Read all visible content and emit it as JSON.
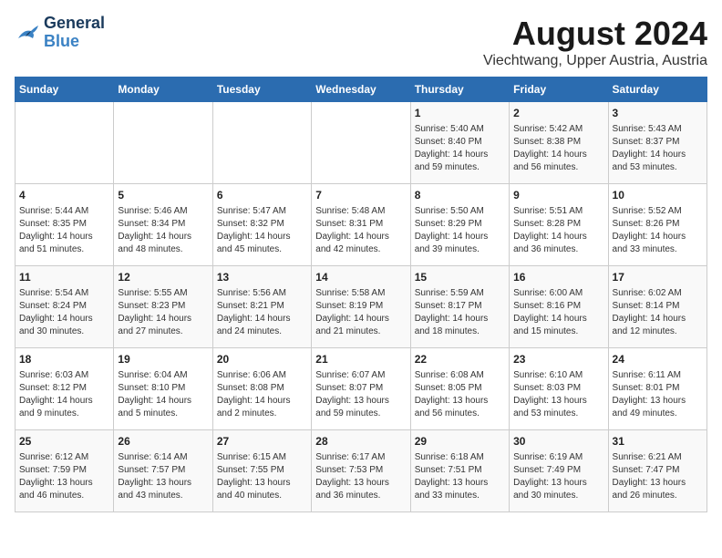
{
  "header": {
    "logo_line1": "General",
    "logo_line2": "Blue",
    "title": "August 2024",
    "subtitle": "Viechtwang, Upper Austria, Austria"
  },
  "calendar": {
    "days_of_week": [
      "Sunday",
      "Monday",
      "Tuesday",
      "Wednesday",
      "Thursday",
      "Friday",
      "Saturday"
    ],
    "weeks": [
      [
        {
          "day": "",
          "detail": ""
        },
        {
          "day": "",
          "detail": ""
        },
        {
          "day": "",
          "detail": ""
        },
        {
          "day": "",
          "detail": ""
        },
        {
          "day": "1",
          "detail": "Sunrise: 5:40 AM\nSunset: 8:40 PM\nDaylight: 14 hours\nand 59 minutes."
        },
        {
          "day": "2",
          "detail": "Sunrise: 5:42 AM\nSunset: 8:38 PM\nDaylight: 14 hours\nand 56 minutes."
        },
        {
          "day": "3",
          "detail": "Sunrise: 5:43 AM\nSunset: 8:37 PM\nDaylight: 14 hours\nand 53 minutes."
        }
      ],
      [
        {
          "day": "4",
          "detail": "Sunrise: 5:44 AM\nSunset: 8:35 PM\nDaylight: 14 hours\nand 51 minutes."
        },
        {
          "day": "5",
          "detail": "Sunrise: 5:46 AM\nSunset: 8:34 PM\nDaylight: 14 hours\nand 48 minutes."
        },
        {
          "day": "6",
          "detail": "Sunrise: 5:47 AM\nSunset: 8:32 PM\nDaylight: 14 hours\nand 45 minutes."
        },
        {
          "day": "7",
          "detail": "Sunrise: 5:48 AM\nSunset: 8:31 PM\nDaylight: 14 hours\nand 42 minutes."
        },
        {
          "day": "8",
          "detail": "Sunrise: 5:50 AM\nSunset: 8:29 PM\nDaylight: 14 hours\nand 39 minutes."
        },
        {
          "day": "9",
          "detail": "Sunrise: 5:51 AM\nSunset: 8:28 PM\nDaylight: 14 hours\nand 36 minutes."
        },
        {
          "day": "10",
          "detail": "Sunrise: 5:52 AM\nSunset: 8:26 PM\nDaylight: 14 hours\nand 33 minutes."
        }
      ],
      [
        {
          "day": "11",
          "detail": "Sunrise: 5:54 AM\nSunset: 8:24 PM\nDaylight: 14 hours\nand 30 minutes."
        },
        {
          "day": "12",
          "detail": "Sunrise: 5:55 AM\nSunset: 8:23 PM\nDaylight: 14 hours\nand 27 minutes."
        },
        {
          "day": "13",
          "detail": "Sunrise: 5:56 AM\nSunset: 8:21 PM\nDaylight: 14 hours\nand 24 minutes."
        },
        {
          "day": "14",
          "detail": "Sunrise: 5:58 AM\nSunset: 8:19 PM\nDaylight: 14 hours\nand 21 minutes."
        },
        {
          "day": "15",
          "detail": "Sunrise: 5:59 AM\nSunset: 8:17 PM\nDaylight: 14 hours\nand 18 minutes."
        },
        {
          "day": "16",
          "detail": "Sunrise: 6:00 AM\nSunset: 8:16 PM\nDaylight: 14 hours\nand 15 minutes."
        },
        {
          "day": "17",
          "detail": "Sunrise: 6:02 AM\nSunset: 8:14 PM\nDaylight: 14 hours\nand 12 minutes."
        }
      ],
      [
        {
          "day": "18",
          "detail": "Sunrise: 6:03 AM\nSunset: 8:12 PM\nDaylight: 14 hours\nand 9 minutes."
        },
        {
          "day": "19",
          "detail": "Sunrise: 6:04 AM\nSunset: 8:10 PM\nDaylight: 14 hours\nand 5 minutes."
        },
        {
          "day": "20",
          "detail": "Sunrise: 6:06 AM\nSunset: 8:08 PM\nDaylight: 14 hours\nand 2 minutes."
        },
        {
          "day": "21",
          "detail": "Sunrise: 6:07 AM\nSunset: 8:07 PM\nDaylight: 13 hours\nand 59 minutes."
        },
        {
          "day": "22",
          "detail": "Sunrise: 6:08 AM\nSunset: 8:05 PM\nDaylight: 13 hours\nand 56 minutes."
        },
        {
          "day": "23",
          "detail": "Sunrise: 6:10 AM\nSunset: 8:03 PM\nDaylight: 13 hours\nand 53 minutes."
        },
        {
          "day": "24",
          "detail": "Sunrise: 6:11 AM\nSunset: 8:01 PM\nDaylight: 13 hours\nand 49 minutes."
        }
      ],
      [
        {
          "day": "25",
          "detail": "Sunrise: 6:12 AM\nSunset: 7:59 PM\nDaylight: 13 hours\nand 46 minutes."
        },
        {
          "day": "26",
          "detail": "Sunrise: 6:14 AM\nSunset: 7:57 PM\nDaylight: 13 hours\nand 43 minutes."
        },
        {
          "day": "27",
          "detail": "Sunrise: 6:15 AM\nSunset: 7:55 PM\nDaylight: 13 hours\nand 40 minutes."
        },
        {
          "day": "28",
          "detail": "Sunrise: 6:17 AM\nSunset: 7:53 PM\nDaylight: 13 hours\nand 36 minutes."
        },
        {
          "day": "29",
          "detail": "Sunrise: 6:18 AM\nSunset: 7:51 PM\nDaylight: 13 hours\nand 33 minutes."
        },
        {
          "day": "30",
          "detail": "Sunrise: 6:19 AM\nSunset: 7:49 PM\nDaylight: 13 hours\nand 30 minutes."
        },
        {
          "day": "31",
          "detail": "Sunrise: 6:21 AM\nSunset: 7:47 PM\nDaylight: 13 hours\nand 26 minutes."
        }
      ]
    ]
  }
}
